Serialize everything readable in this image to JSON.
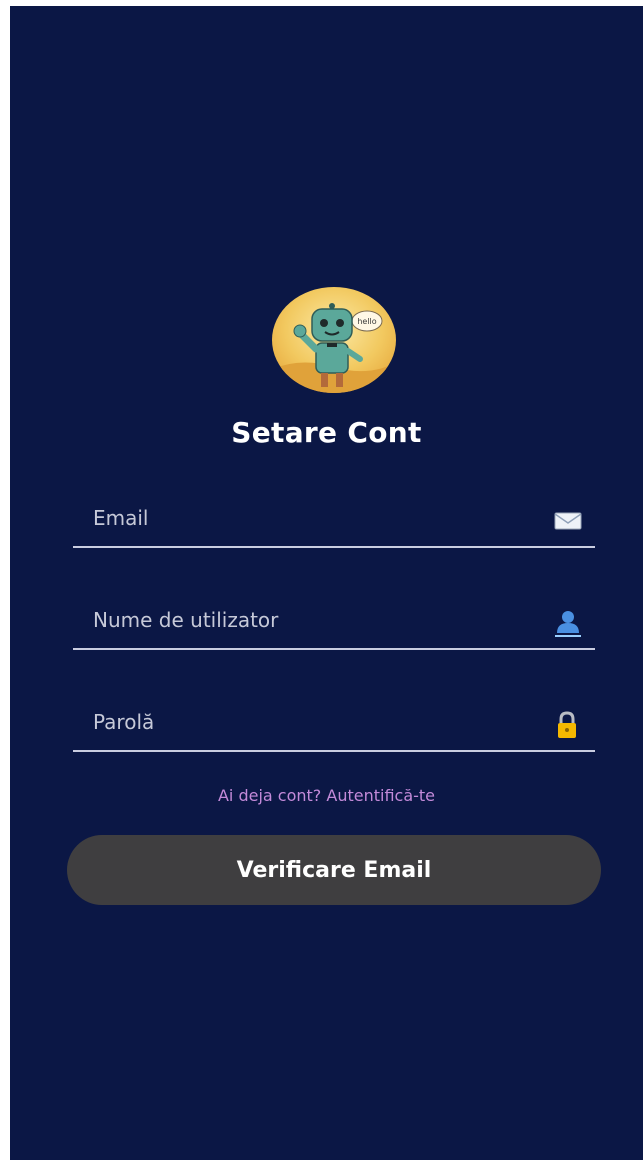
{
  "page": {
    "title": "Setare Cont",
    "background_color": "#0b1745"
  },
  "avatar": {
    "speech_bubble_text": "hello"
  },
  "fields": [
    {
      "placeholder": "Email",
      "value": "",
      "icon": "envelope-icon"
    },
    {
      "placeholder": "Nume de utilizator",
      "value": "",
      "icon": "user-icon"
    },
    {
      "placeholder": "Parolă",
      "value": "",
      "icon": "lock-icon"
    }
  ],
  "login_link": "Ai deja cont? Autentifică-te",
  "primary_button": {
    "label": "Verificare Email",
    "color": "#3f3e40"
  },
  "colors": {
    "link": "#c38ad9",
    "field_line": "#c9cde0"
  }
}
